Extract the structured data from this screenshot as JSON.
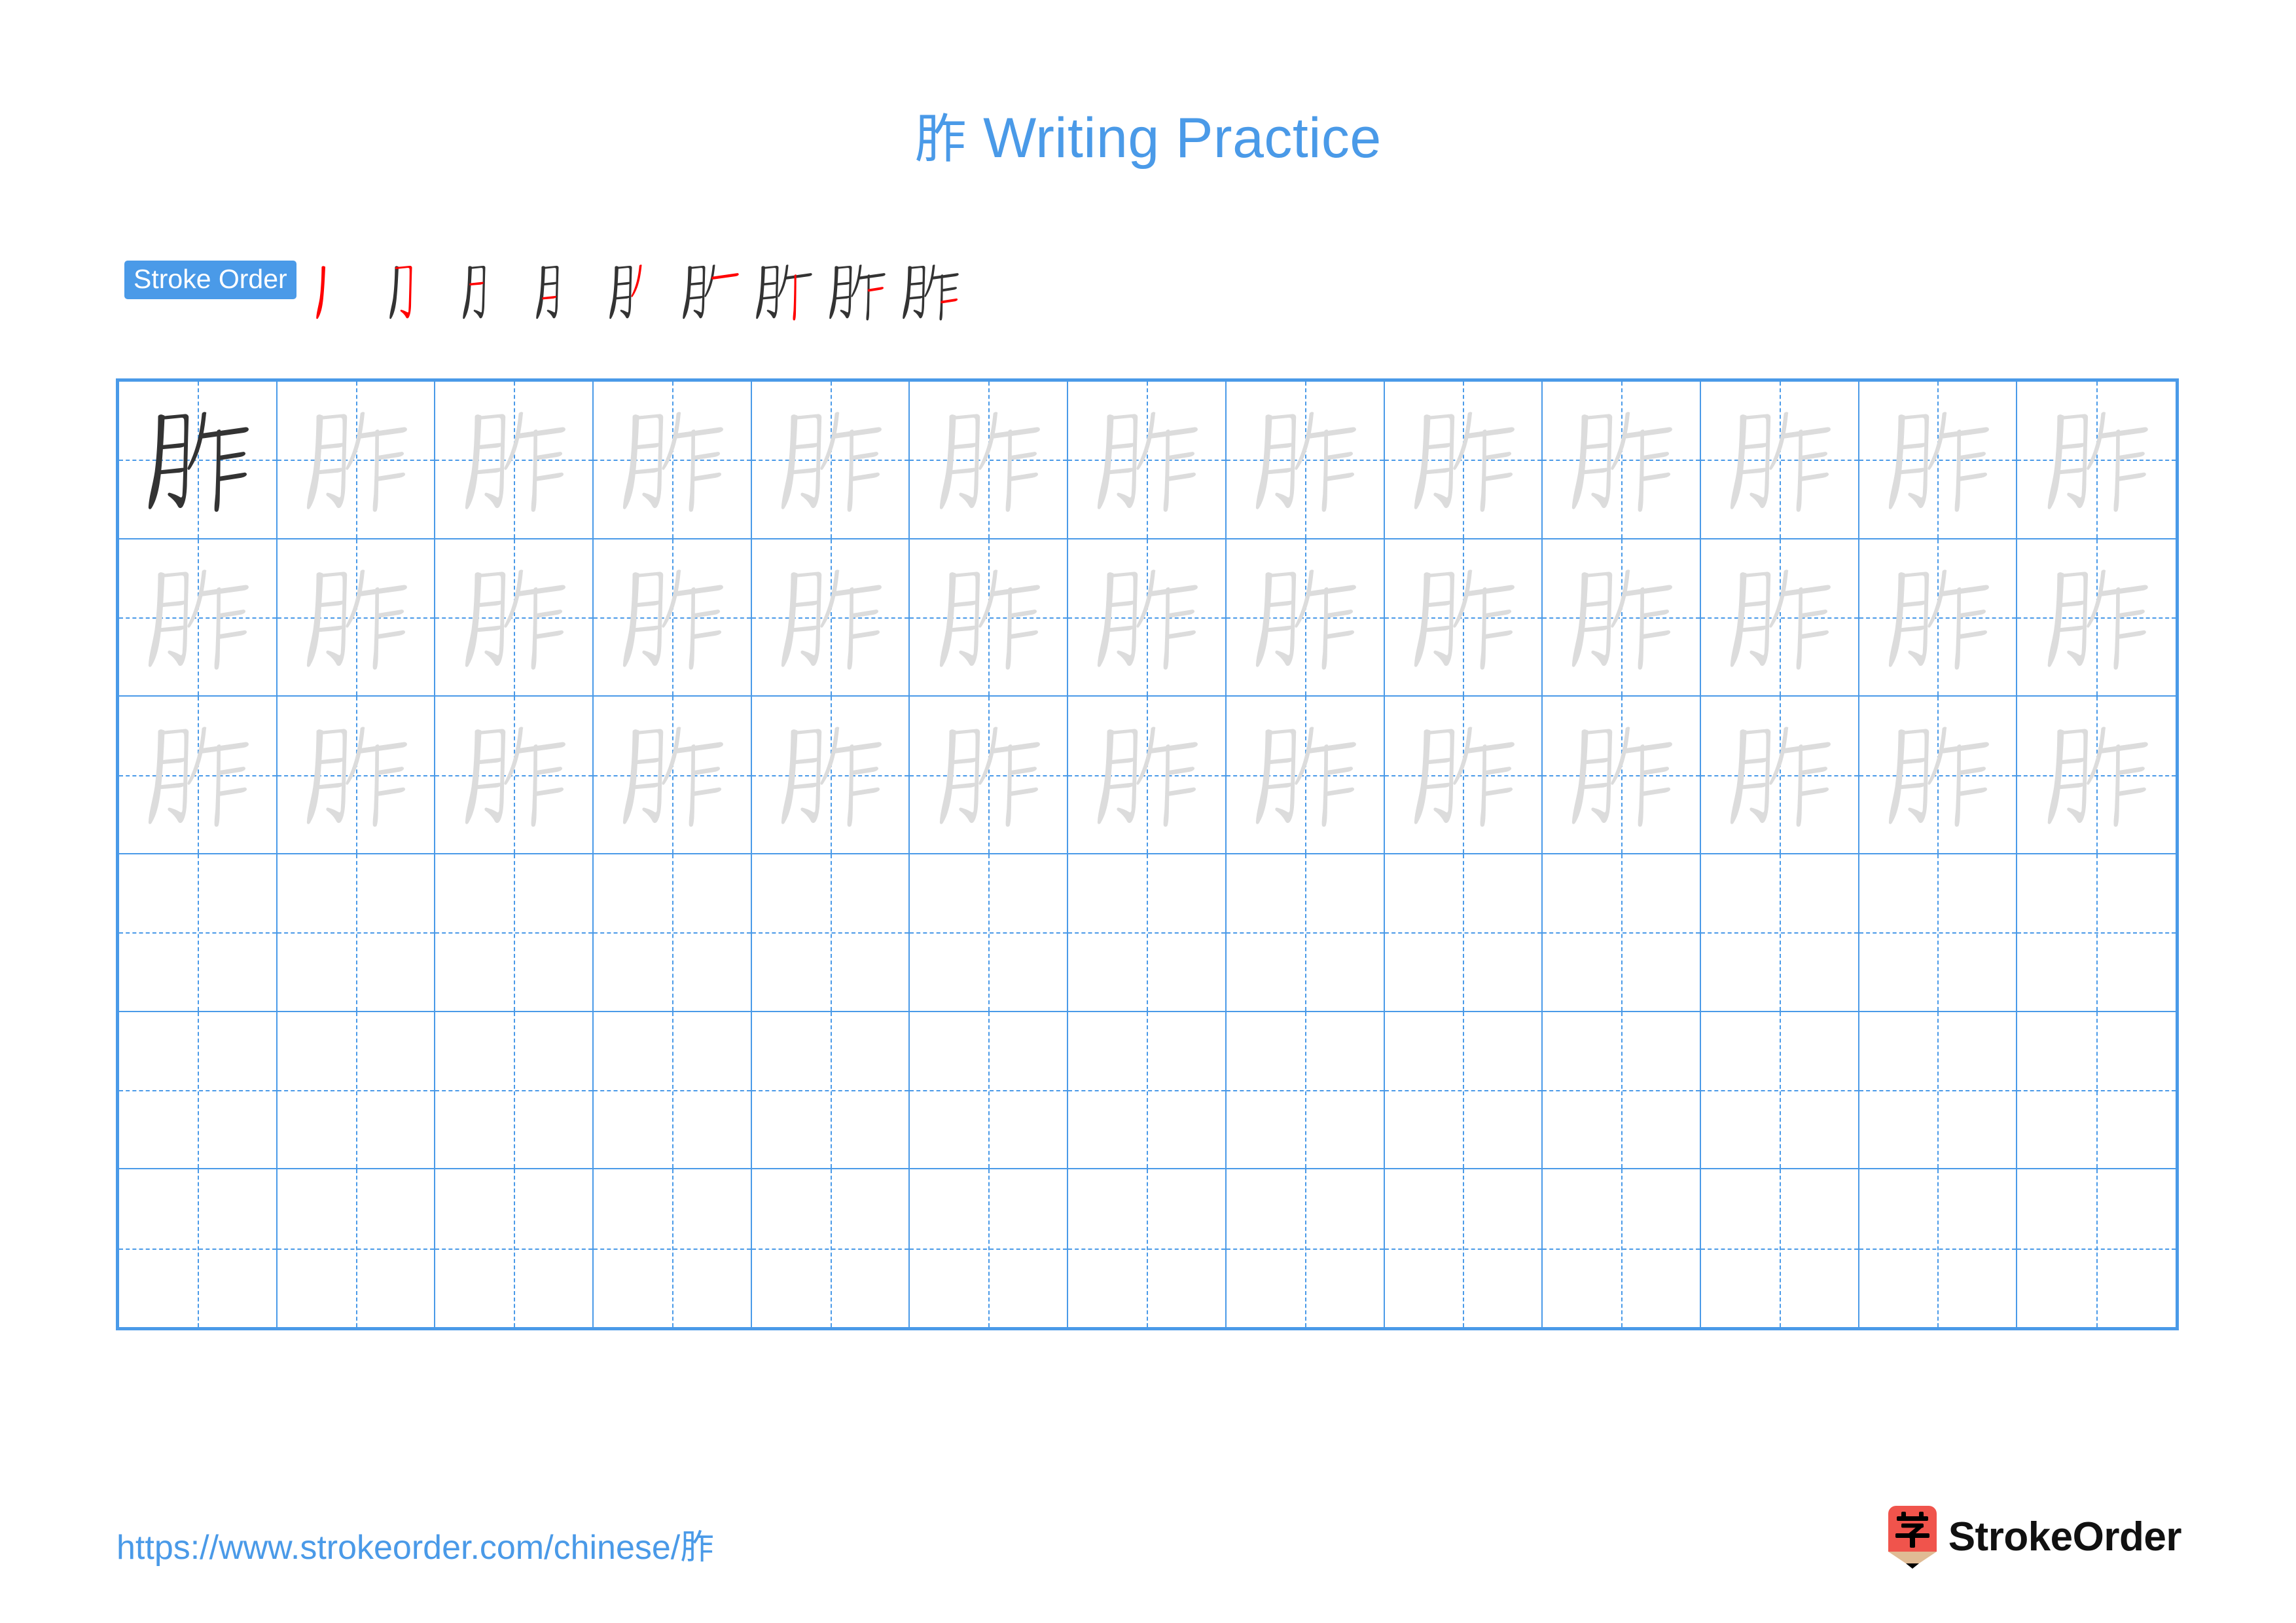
{
  "page": {
    "character": "胙",
    "title": "胙 Writing Practice",
    "title_suffix": " Writing Practice",
    "background_color": "#ffffff",
    "accent_color": "#4a9ae8",
    "ink_color": "#333333",
    "trace_color": "#dcdcdc",
    "highlight_stroke_color": "#ff0000"
  },
  "stroke_order": {
    "badge_label": "Stroke Order",
    "total_strokes": 9,
    "steps": [
      {
        "index": 1,
        "strokes_shown": 1,
        "new_stroke_name": "pie"
      },
      {
        "index": 2,
        "strokes_shown": 2,
        "new_stroke_name": "heng-zhe-gou"
      },
      {
        "index": 3,
        "strokes_shown": 3,
        "new_stroke_name": "heng"
      },
      {
        "index": 4,
        "strokes_shown": 4,
        "new_stroke_name": "heng"
      },
      {
        "index": 5,
        "strokes_shown": 5,
        "new_stroke_name": "pie"
      },
      {
        "index": 6,
        "strokes_shown": 6,
        "new_stroke_name": "heng"
      },
      {
        "index": 7,
        "strokes_shown": 7,
        "new_stroke_name": "shu"
      },
      {
        "index": 8,
        "strokes_shown": 8,
        "new_stroke_name": "heng"
      },
      {
        "index": 9,
        "strokes_shown": 9,
        "new_stroke_name": "heng"
      }
    ]
  },
  "practice_grid": {
    "columns": 13,
    "rows": 6,
    "filled_rows": 3,
    "blank_rows": 3,
    "solid_cell_index": 0,
    "grid_line_color": "#4a9ae8",
    "cells_total": 78
  },
  "footer": {
    "url": "https://www.strokeorder.com/chinese/胙",
    "url_prefix": "https://www.strokeorder.com/chinese/",
    "brand_name": "StrokeOrder",
    "brand_mark_character": "字",
    "brand_mark_colors": {
      "body": "#f0544c",
      "wood": "#e0bb94",
      "tip": "#000000"
    }
  }
}
